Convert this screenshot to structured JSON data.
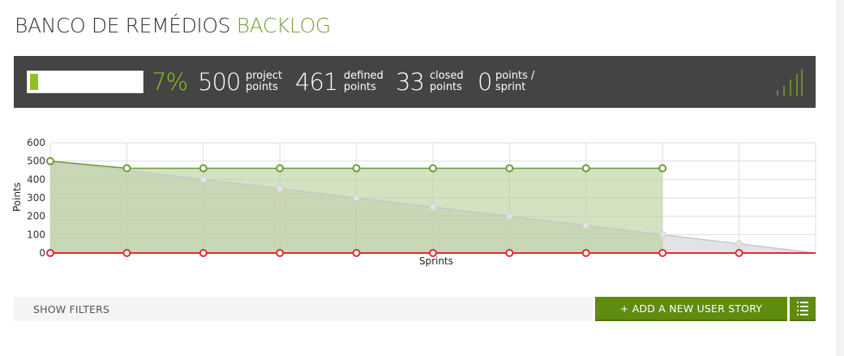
{
  "header": {
    "title": "BANCO DE REMÉDIOS",
    "subtitle": "BACKLOG"
  },
  "stats": {
    "progress_fraction": 0.07,
    "percent_label": "7%",
    "project_points": {
      "value": "500",
      "label_line1": "project",
      "label_line2": "points"
    },
    "defined_points": {
      "value": "461",
      "label_line1": "defined",
      "label_line2": "points"
    },
    "closed_points": {
      "value": "33",
      "label_line1": "closed",
      "label_line2": "points"
    },
    "points_per_sprint": {
      "value": "0",
      "label_line1": "points /",
      "label_line2": "sprint"
    },
    "mini_chart_icon": "bar-chart-icon"
  },
  "colors": {
    "accent_green": "#8fc01c",
    "defined_line": "#6a9a37",
    "defined_fill": "#b5cf96",
    "ideal_fill": "#cccccc",
    "closed_line": "#e8282f",
    "button_green": "#5f8b0f",
    "stats_background": "#444444"
  },
  "chart_data": {
    "type": "line",
    "xlabel": "Sprints",
    "ylabel": "Points",
    "ylim": [
      0,
      600
    ],
    "yticks": [
      "0",
      "100",
      "200",
      "300",
      "400",
      "500",
      "600"
    ],
    "x_count": 11,
    "grid": true,
    "series": [
      {
        "key": "ideal",
        "values": [
          500,
          450,
          400,
          350,
          300,
          250,
          200,
          150,
          100,
          50,
          0
        ]
      },
      {
        "key": "defined",
        "values": [
          500,
          461,
          461,
          461,
          461,
          461,
          461,
          461,
          461
        ]
      },
      {
        "key": "closed",
        "values": [
          0,
          0,
          0,
          0,
          0,
          0,
          0,
          0,
          0,
          0
        ]
      }
    ]
  },
  "toolbar": {
    "show_filters_label": "SHOW FILTERS",
    "add_story_label": "+ ADD A NEW USER STORY",
    "list_icon": "list-icon"
  }
}
